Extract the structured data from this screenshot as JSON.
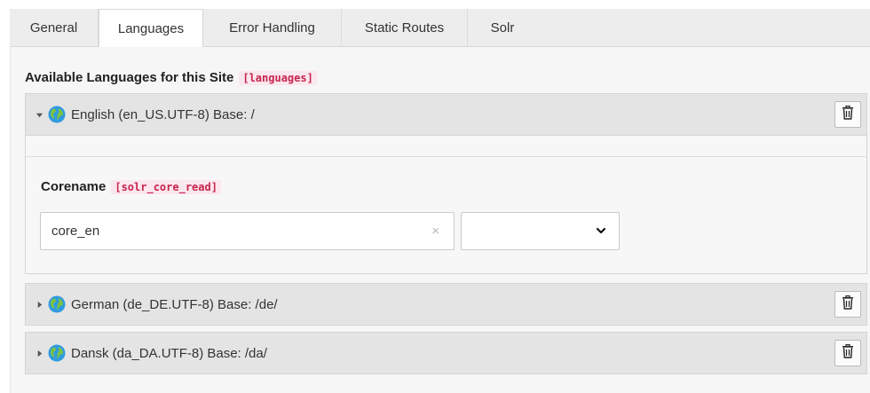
{
  "tabs": [
    {
      "label": "General",
      "active": false
    },
    {
      "label": "Languages",
      "active": true
    },
    {
      "label": "Error Handling",
      "active": false
    },
    {
      "label": "Static Routes",
      "active": false
    },
    {
      "label": "Solr",
      "active": false
    }
  ],
  "section": {
    "title": "Available Languages for this Site",
    "code": "[languages]"
  },
  "languages": [
    {
      "label": "English (en_US.UTF-8) Base: /",
      "expanded": true,
      "field": {
        "label": "Corename",
        "code": "[solr_core_read]",
        "value": "core_en",
        "clear_icon": "×",
        "select_value": ""
      }
    },
    {
      "label": "German (de_DE.UTF-8) Base: /de/",
      "expanded": false
    },
    {
      "label": "Dansk (da_DA.UTF-8) Base: /da/",
      "expanded": false
    }
  ],
  "icons": {
    "expanded": "caret-down-icon",
    "collapsed": "caret-right-icon",
    "globe": "globe-icon",
    "delete": "trash-icon",
    "select": "chevron-down-icon"
  },
  "colors": {
    "code_text": "#c7254e",
    "code_bg": "#fbe7ee",
    "globe_water": "#2f9be0",
    "globe_land": "#7cc243"
  }
}
